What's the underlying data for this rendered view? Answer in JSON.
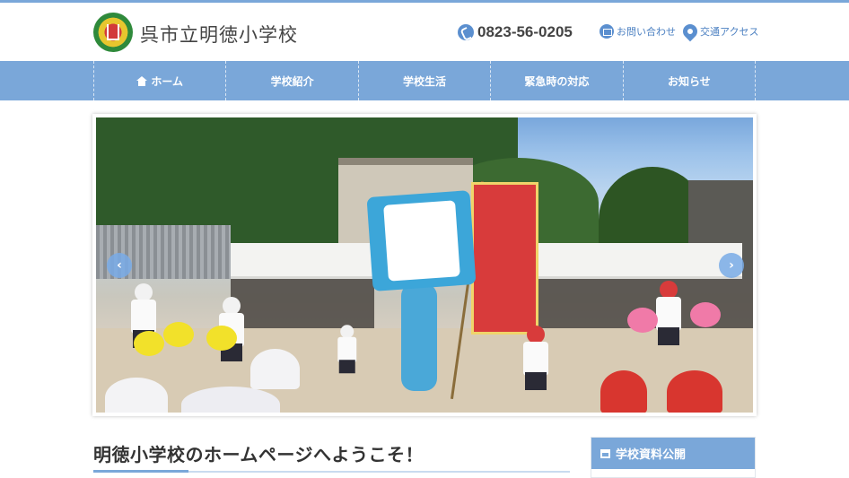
{
  "header": {
    "site_title": "呉市立明徳小学校",
    "phone": "0823-56-0205",
    "contact_label": "お問い合わせ",
    "access_label": "交通アクセス"
  },
  "nav": {
    "items": [
      {
        "label": "ホーム",
        "icon": "home-icon"
      },
      {
        "label": "学校紹介"
      },
      {
        "label": "学校生活"
      },
      {
        "label": "緊急時の対応"
      },
      {
        "label": "お知らせ"
      }
    ]
  },
  "slider": {
    "prev": "‹",
    "next": "›"
  },
  "main": {
    "heading": "明徳小学校のホームページへようこそ！"
  },
  "sidebar": {
    "widget_title": "学校資料公開"
  },
  "colors": {
    "accent": "#7aa7d9",
    "link": "#4a7fc1"
  }
}
